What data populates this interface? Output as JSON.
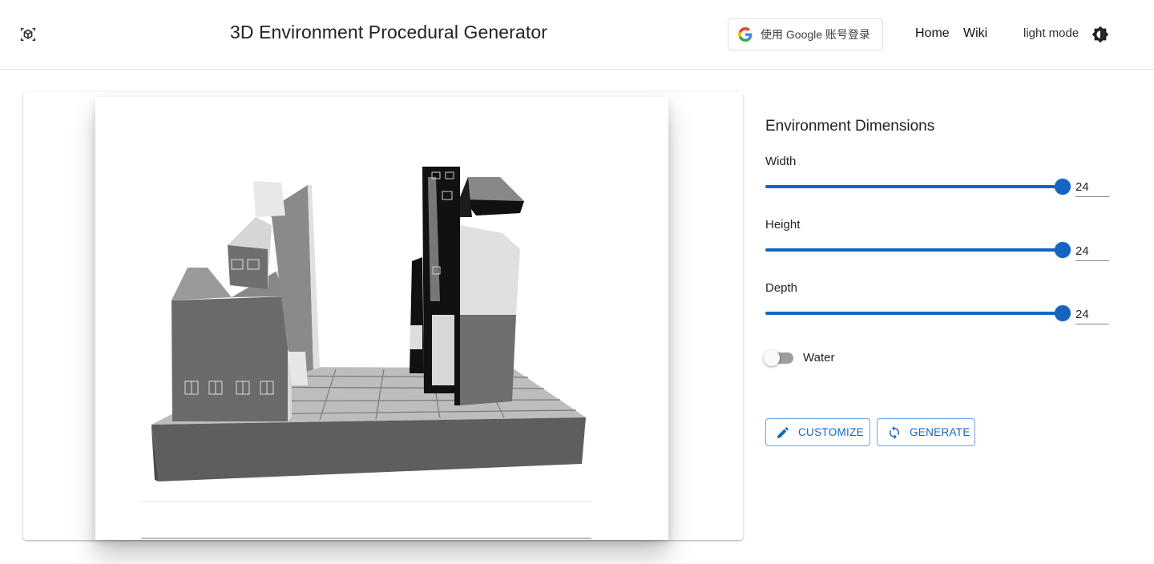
{
  "header": {
    "title": "3D Environment Procedural Generator",
    "google_signin_label": "使用 Google 账号登录",
    "nav": {
      "home": "Home",
      "wiki": "Wiki"
    },
    "mode_label": "light mode",
    "icons": {
      "logo": "cube-logo-icon",
      "google": "google-g-icon",
      "mode": "brightness-toggle-icon"
    }
  },
  "panel": {
    "title": "Environment Dimensions",
    "sliders": [
      {
        "label": "Width",
        "value": "24",
        "fraction": 1.0
      },
      {
        "label": "Height",
        "value": "24",
        "fraction": 1.0
      },
      {
        "label": "Depth",
        "value": "24",
        "fraction": 1.0
      }
    ],
    "water": {
      "label": "Water",
      "checked": false
    },
    "buttons": {
      "customize": "CUSTOMIZE",
      "generate": "GENERATE"
    }
  },
  "colors": {
    "accent": "#1565c0"
  }
}
